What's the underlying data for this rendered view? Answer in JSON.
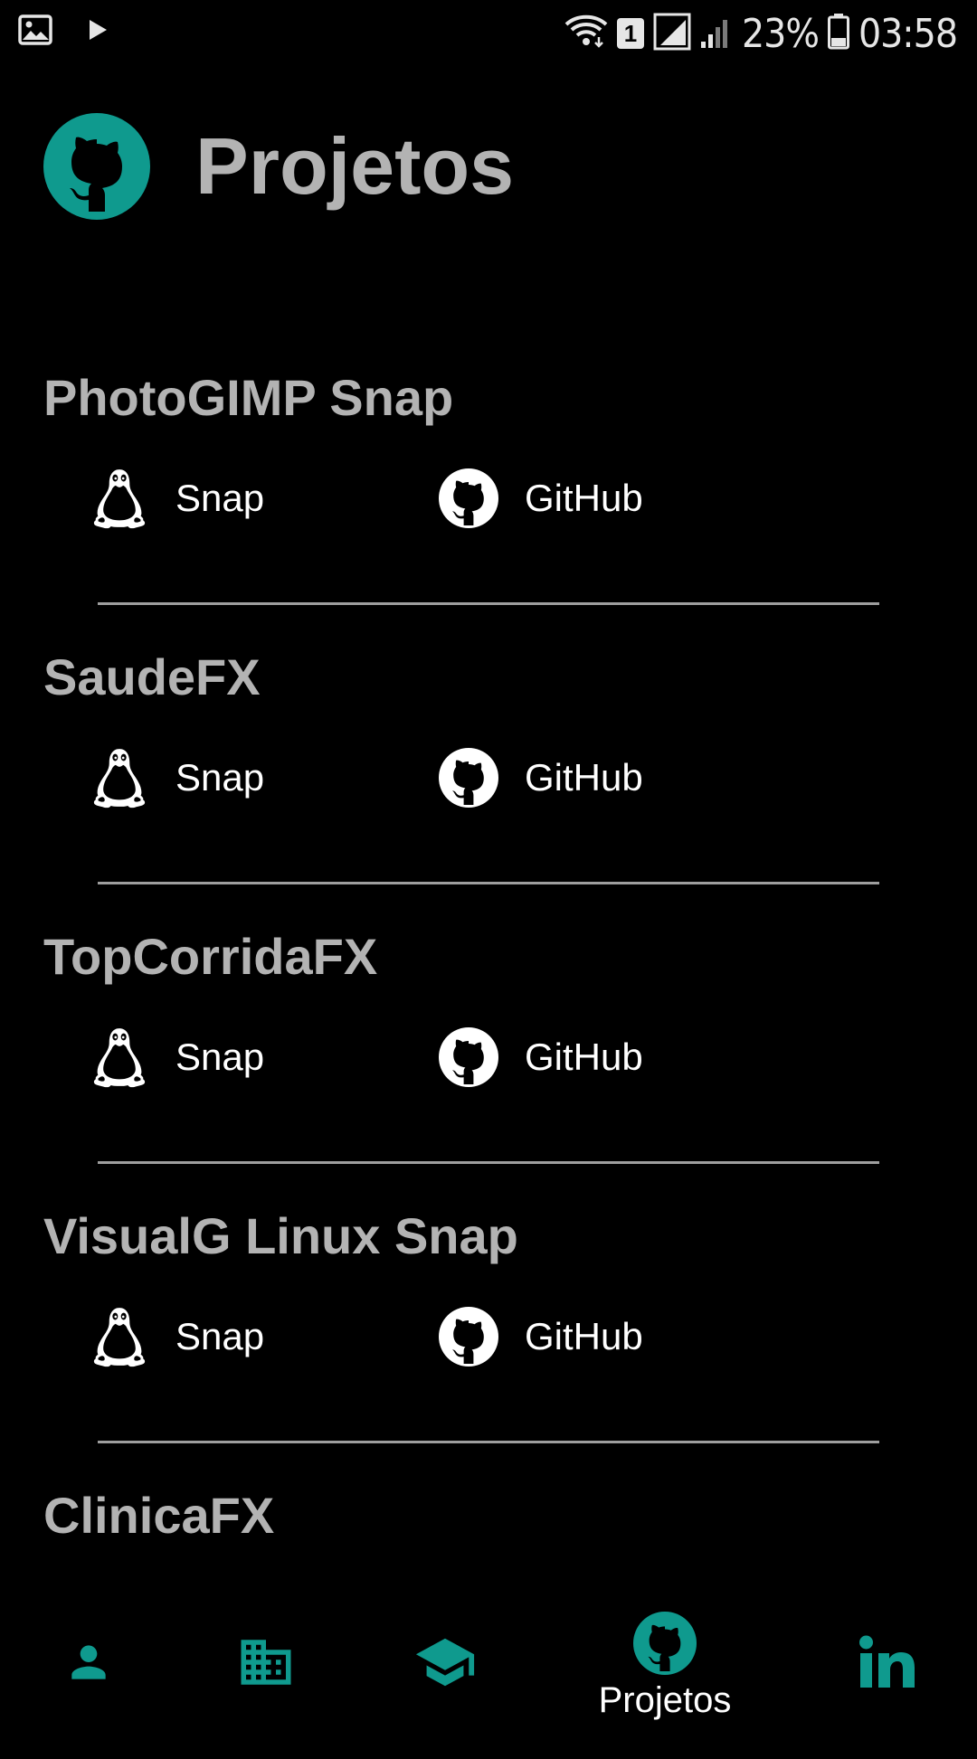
{
  "status_bar": {
    "sim_slot": "1",
    "battery": "23%",
    "time": "03:58",
    "icons": [
      "image-icon",
      "play-icon",
      "wifi-icon",
      "sim-icon",
      "signal-icon",
      "signal-icon",
      "battery-icon"
    ]
  },
  "header": {
    "title": "Projetos",
    "logo_icon": "github-icon"
  },
  "colors": {
    "accent": "#0f9a8e",
    "title_gray": "#b3b3b3",
    "background": "#000000",
    "divider": "#9e9e9e"
  },
  "projects": [
    {
      "name": "PhotoGIMP Snap",
      "snap_label": "Snap",
      "github_label": "GitHub"
    },
    {
      "name": "SaudeFX",
      "snap_label": "Snap",
      "github_label": "GitHub"
    },
    {
      "name": "TopCorridaFX",
      "snap_label": "Snap",
      "github_label": "GitHub"
    },
    {
      "name": "VisualG Linux Snap",
      "snap_label": "Snap",
      "github_label": "GitHub"
    },
    {
      "name": "ClinicaFX"
    }
  ],
  "bottom_nav": {
    "items": [
      {
        "icon": "person-icon",
        "label": ""
      },
      {
        "icon": "business-icon",
        "label": ""
      },
      {
        "icon": "school-icon",
        "label": ""
      },
      {
        "icon": "github-icon",
        "label": "Projetos",
        "active": true
      },
      {
        "icon": "linkedin-icon",
        "label": ""
      }
    ]
  }
}
